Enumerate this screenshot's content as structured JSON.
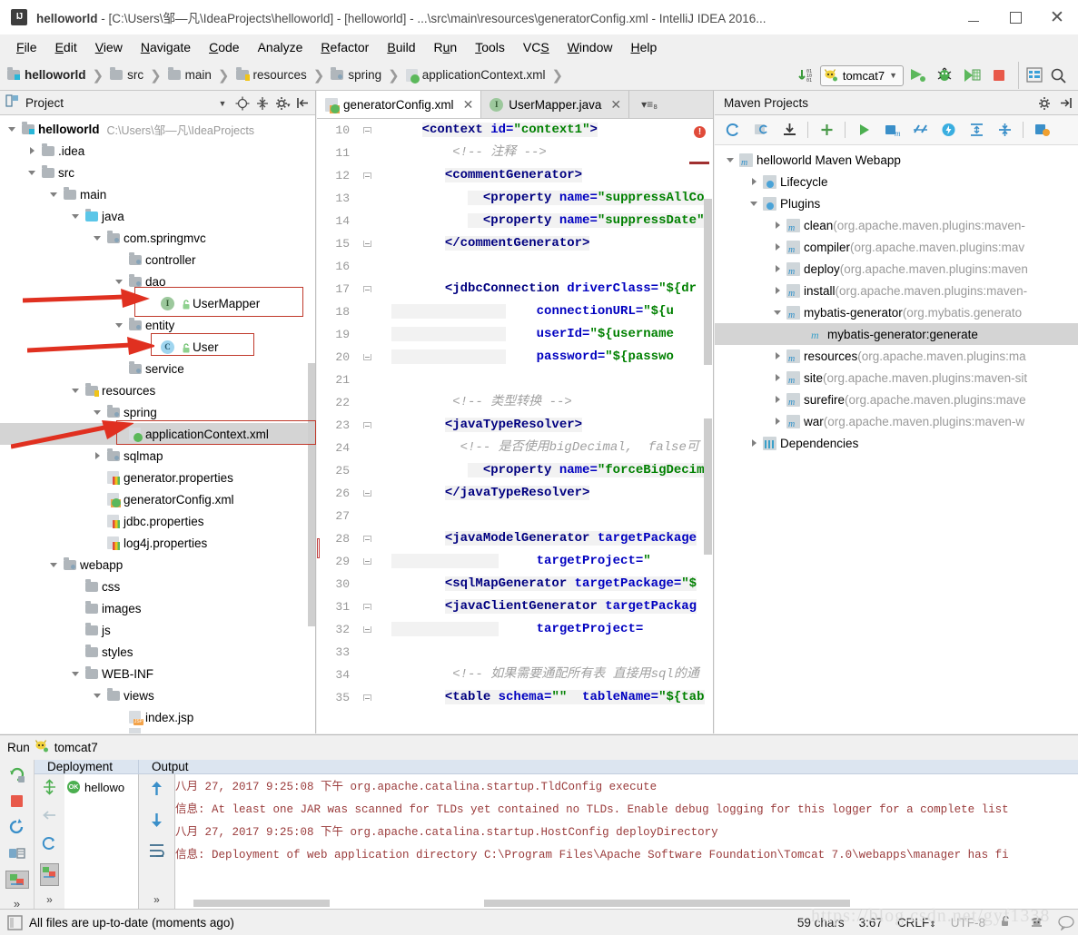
{
  "window": {
    "title_prefix": "helloworld",
    "title_rest": " - [C:\\Users\\邹—凡\\IdeaProjects\\helloworld] - [helloworld] - ...\\src\\main\\resources\\generatorConfig.xml - IntelliJ IDEA 2016...",
    "app_icon": "IJ",
    "minimize": "—",
    "maximize": "□",
    "close": "✕"
  },
  "menubar": {
    "items": [
      "File",
      "Edit",
      "View",
      "Navigate",
      "Code",
      "Analyze",
      "Refactor",
      "Build",
      "Run",
      "Tools",
      "VCS",
      "Window",
      "Help"
    ]
  },
  "navbar": {
    "breadcrumbs": [
      {
        "label": "helloworld",
        "icon": "module-folder-icon",
        "bold": true
      },
      {
        "label": "src",
        "icon": "folder-icon",
        "bold": false
      },
      {
        "label": "main",
        "icon": "folder-icon",
        "bold": false
      },
      {
        "label": "resources",
        "icon": "resources-folder-icon",
        "bold": false
      },
      {
        "label": "spring",
        "icon": "source-folder-icon",
        "bold": false
      },
      {
        "label": "applicationContext.xml",
        "icon": "xml-file-icon",
        "bold": false
      }
    ],
    "run_config": "tomcat7",
    "toolbar_icons": [
      "update-project-icon",
      "run-icon",
      "debug-icon",
      "run-coverage-icon",
      "stop-icon",
      "project-structure-icon",
      "search-everywhere-icon"
    ]
  },
  "project_panel": {
    "title": "Project",
    "tools": [
      "collapse-dropdown-icon",
      "locate-icon",
      "collapse-all-icon",
      "settings-gear-icon",
      "hide-icon"
    ],
    "tree": [
      {
        "depth": 0,
        "twisty": "down",
        "icon": "module-folder-icon",
        "label": "helloworld",
        "bold": true,
        "path": "C:\\Users\\邹—凡\\IdeaProjects"
      },
      {
        "depth": 1,
        "twisty": "right",
        "icon": "folder-icon",
        "label": ".idea"
      },
      {
        "depth": 1,
        "twisty": "down",
        "icon": "folder-icon",
        "label": "src"
      },
      {
        "depth": 2,
        "twisty": "down",
        "icon": "folder-icon",
        "label": "main"
      },
      {
        "depth": 3,
        "twisty": "down",
        "icon": "source-root-icon",
        "label": "java"
      },
      {
        "depth": 4,
        "twisty": "down",
        "icon": "package-icon",
        "label": "com.springmvc"
      },
      {
        "depth": 5,
        "twisty": "none",
        "icon": "package-icon",
        "label": "controller"
      },
      {
        "depth": 5,
        "twisty": "down",
        "icon": "package-icon",
        "label": "dao"
      },
      {
        "depth": 6,
        "twisty": "none",
        "icon": "interface-icon",
        "label": "UserMapper",
        "annotated": true
      },
      {
        "depth": 5,
        "twisty": "down",
        "icon": "package-icon",
        "label": "entity"
      },
      {
        "depth": 6,
        "twisty": "none",
        "icon": "class-icon",
        "label": "User",
        "annotated": true
      },
      {
        "depth": 5,
        "twisty": "none",
        "icon": "package-icon",
        "label": "service"
      },
      {
        "depth": 3,
        "twisty": "down",
        "icon": "resources-folder-icon",
        "label": "resources"
      },
      {
        "depth": 4,
        "twisty": "down",
        "icon": "package-icon",
        "label": "spring"
      },
      {
        "depth": 5,
        "twisty": "none",
        "icon": "xml-file-icon",
        "label": "applicationContext.xml",
        "selected": true,
        "annotated": true
      },
      {
        "depth": 4,
        "twisty": "right",
        "icon": "package-icon",
        "label": "sqlmap"
      },
      {
        "depth": 4,
        "twisty": "none",
        "icon": "properties-file-icon",
        "label": "generator.properties"
      },
      {
        "depth": 4,
        "twisty": "none",
        "icon": "xml-code-file-icon",
        "label": "generatorConfig.xml"
      },
      {
        "depth": 4,
        "twisty": "none",
        "icon": "properties-file-icon",
        "label": "jdbc.properties"
      },
      {
        "depth": 4,
        "twisty": "none",
        "icon": "properties-file-icon",
        "label": "log4j.properties"
      },
      {
        "depth": 2,
        "twisty": "down",
        "icon": "webapp-folder-icon",
        "label": "webapp"
      },
      {
        "depth": 3,
        "twisty": "none",
        "icon": "folder-icon",
        "label": "css"
      },
      {
        "depth": 3,
        "twisty": "none",
        "icon": "folder-icon",
        "label": "images"
      },
      {
        "depth": 3,
        "twisty": "none",
        "icon": "folder-icon",
        "label": "js"
      },
      {
        "depth": 3,
        "twisty": "none",
        "icon": "folder-icon",
        "label": "styles"
      },
      {
        "depth": 3,
        "twisty": "down",
        "icon": "folder-icon",
        "label": "WEB-INF"
      },
      {
        "depth": 4,
        "twisty": "down",
        "icon": "folder-icon",
        "label": "views"
      },
      {
        "depth": 5,
        "twisty": "none",
        "icon": "jsp-file-icon",
        "label": "index.jsp"
      }
    ]
  },
  "editor": {
    "tabs": [
      {
        "label": "generatorConfig.xml",
        "icon": "xml-code-file-icon",
        "active": true,
        "close": "✕"
      },
      {
        "label": "UserMapper.java",
        "icon": "interface-icon",
        "active": false,
        "close": "✕"
      }
    ],
    "tab_more": "▾≡₈",
    "error_badge": "!",
    "first_line": 10,
    "lines": [
      {
        "n": 10,
        "fold": "start",
        "html": "    <span class='hl'><span class='tag'>&lt;context </span><span class='attr'>id=</span><span class='str'>\"context1\"</span><span class='tag'>&gt;</span></span>"
      },
      {
        "n": 11,
        "fold": "",
        "html": "        <span class='cmt'>&lt;!-- 注释 --&gt;</span>"
      },
      {
        "n": 12,
        "fold": "start",
        "html": "       <span class='hl'><span class='tag'>&lt;commentGenerator&gt;</span></span>"
      },
      {
        "n": 13,
        "fold": "",
        "html": "          <span class='hl'>  <span class='tag'>&lt;property </span><span class='attr'>name=</span><span class='str'>\"suppressAllCo</span></span>"
      },
      {
        "n": 14,
        "fold": "",
        "html": "          <span class='hl'>  <span class='tag'>&lt;property </span><span class='attr'>name=</span><span class='str'>\"suppressDate\"</span></span>"
      },
      {
        "n": 15,
        "fold": "end",
        "html": "       <span class='hl'><span class='tag'>&lt;/commentGenerator&gt;</span></span>"
      },
      {
        "n": 16,
        "fold": "",
        "html": ""
      },
      {
        "n": 17,
        "fold": "start",
        "html": "       <span class='tag'>&lt;jdbcConnection </span><span class='attr'>driverClass=</span><span class='str'>\"$&#123;dr</span>"
      },
      {
        "n": 18,
        "fold": "",
        "html": "<span class='hl'>               </span>    <span class='attr'>connectionURL=</span><span class='str'>\"$&#123;u</span>"
      },
      {
        "n": 19,
        "fold": "",
        "html": "<span class='hl'>               </span>    <span class='attr'>userId=</span><span class='str'>\"$&#123;username</span>"
      },
      {
        "n": 20,
        "fold": "end",
        "html": "<span class='hl'>               </span>    <span class='attr'>password=</span><span class='str'>\"$&#123;passwo</span>"
      },
      {
        "n": 21,
        "fold": "",
        "html": ""
      },
      {
        "n": 22,
        "fold": "",
        "html": "        <span class='cmt'>&lt;!-- 类型转换 --&gt;</span>"
      },
      {
        "n": 23,
        "fold": "start",
        "html": "       <span class='hl'><span class='tag'>&lt;javaTypeResolver&gt;</span></span>"
      },
      {
        "n": 24,
        "fold": "",
        "html": "         <span class='cmt'>&lt;!-- 是否使用bigDecimal,  false可</span>"
      },
      {
        "n": 25,
        "fold": "",
        "html": "          <span class='hl'>  <span class='tag'>&lt;property </span><span class='attr'>name=</span><span class='str'>\"forceBigDecim</span></span>"
      },
      {
        "n": 26,
        "fold": "end",
        "html": "       <span class='hl'><span class='tag'>&lt;/javaTypeResolver&gt;</span></span>"
      },
      {
        "n": 27,
        "fold": "",
        "html": ""
      },
      {
        "n": 28,
        "fold": "start",
        "html": "       <span class='hl'><span class='tag'>&lt;javaModelGenerator </span><span class='attr'>targetPackage</span></span>"
      },
      {
        "n": 29,
        "fold": "end",
        "html": "<span class='hl'>              </span>     <span class='attr'>targetProject=</span><span class='str'>\"</span>"
      },
      {
        "n": 30,
        "fold": "",
        "html": "       <span class='hl'><span class='tag'>&lt;sqlMapGenerator </span><span class='attr'>targetPackage=</span><span class='str'>\"$</span></span>"
      },
      {
        "n": 31,
        "fold": "start",
        "html": "       <span class='hl'><span class='tag'>&lt;javaClientGenerator </span><span class='attr'>targetPackag</span></span>"
      },
      {
        "n": 32,
        "fold": "end",
        "html": "<span class='hl'>              </span>     <span class='attr'>targetProject=</span>"
      },
      {
        "n": 33,
        "fold": "",
        "html": ""
      },
      {
        "n": 34,
        "fold": "",
        "html": "        <span class='cmt'>&lt;!-- 如果需要通配所有表 直接用sql的通</span>"
      },
      {
        "n": 35,
        "fold": "start",
        "html": "       <span class='hl'><span class='tag'>&lt;table </span><span class='attr'>schema=</span><span class='str'>\"\"</span><span class='attr'>  tableName=</span><span class='str'>\"$&#123;tab</span></span>"
      }
    ]
  },
  "maven_panel": {
    "title": "Maven Projects",
    "head_tools": [
      "settings-gear-icon",
      "hide-icon"
    ],
    "toolbar_icons": [
      "reimport-icon",
      "generate-sources-icon",
      "download-sources-icon",
      "add-icon",
      "run-icon",
      "run-maven-goal-icon",
      "toggle-skip-tests-icon",
      "execute-icon",
      "expand-icon",
      "collapse-icon",
      "maven-settings-icon"
    ],
    "tree": [
      {
        "depth": 0,
        "twisty": "down",
        "icon": "maven-project-icon",
        "label": "helloworld Maven Webapp",
        "gray": ""
      },
      {
        "depth": 1,
        "twisty": "right",
        "icon": "lifecycle-icon",
        "label": "Lifecycle",
        "gray": ""
      },
      {
        "depth": 1,
        "twisty": "down",
        "icon": "plugins-icon",
        "label": "Plugins",
        "gray": ""
      },
      {
        "depth": 2,
        "twisty": "right",
        "icon": "maven-plugin-icon",
        "label": "clean",
        "gray": " (org.apache.maven.plugins:maven-"
      },
      {
        "depth": 2,
        "twisty": "right",
        "icon": "maven-plugin-icon",
        "label": "compiler",
        "gray": " (org.apache.maven.plugins:mav"
      },
      {
        "depth": 2,
        "twisty": "right",
        "icon": "maven-plugin-icon",
        "label": "deploy",
        "gray": " (org.apache.maven.plugins:maven"
      },
      {
        "depth": 2,
        "twisty": "right",
        "icon": "maven-plugin-icon",
        "label": "install",
        "gray": " (org.apache.maven.plugins:maven-"
      },
      {
        "depth": 2,
        "twisty": "down",
        "icon": "maven-plugin-icon",
        "label": "mybatis-generator",
        "gray": " (org.mybatis.generato"
      },
      {
        "depth": 3,
        "twisty": "none",
        "icon": "maven-goal-icon",
        "label": "mybatis-generator:generate",
        "gray": "",
        "selected": true
      },
      {
        "depth": 2,
        "twisty": "right",
        "icon": "maven-plugin-icon",
        "label": "resources",
        "gray": " (org.apache.maven.plugins:ma"
      },
      {
        "depth": 2,
        "twisty": "right",
        "icon": "maven-plugin-icon",
        "label": "site",
        "gray": " (org.apache.maven.plugins:maven-sit"
      },
      {
        "depth": 2,
        "twisty": "right",
        "icon": "maven-plugin-icon",
        "label": "surefire",
        "gray": " (org.apache.maven.plugins:mave"
      },
      {
        "depth": 2,
        "twisty": "right",
        "icon": "maven-plugin-icon",
        "label": "war",
        "gray": " (org.apache.maven.plugins:maven-w"
      },
      {
        "depth": 1,
        "twisty": "right",
        "icon": "dependencies-icon",
        "label": "Dependencies",
        "gray": ""
      }
    ]
  },
  "run_panel": {
    "title": "Run",
    "config_name": "tomcat7",
    "side_icons": [
      "rerun-icon",
      "stop-icon",
      "restart-icon",
      "show-console-icon",
      "deploy-icon"
    ],
    "tabs": [
      {
        "label": "Deployment",
        "active": false
      },
      {
        "label": "Output",
        "active": true
      }
    ],
    "deployment_icons": [
      "sort-icon",
      "back-icon",
      "refresh-icon",
      "deploy-artifact-icon"
    ],
    "deployment_items": [
      {
        "label": "hellowo",
        "status": "ok"
      }
    ],
    "output_icons": [
      "up-arrow-icon",
      "down-arrow-icon",
      "soft-wrap-icon"
    ],
    "output_lines": [
      "八月 27, 2017 9:25:08 下午 org.apache.catalina.startup.TldConfig execute",
      "信息: At least one JAR was scanned for TLDs yet contained no TLDs. Enable debug logging for this logger for a complete list",
      "八月 27, 2017 9:25:08 下午 org.apache.catalina.startup.HostConfig deployDirectory",
      "信息: Deployment of web application directory C:\\Program Files\\Apache Software Foundation\\Tomcat 7.0\\webapps\\manager has fi"
    ]
  },
  "statusbar": {
    "message": "All files are up-to-date (moments ago)",
    "chars": "59 chars",
    "caret": "3:67",
    "line_separator": "CRLF",
    "encoding": "UTF-8",
    "lock_icon": "unlocked-icon",
    "hector_icon": "hector-icon",
    "event_icon": "event-log-icon"
  },
  "watermark": "https://blog.csdn.net/gyf1338",
  "colors": {
    "annotation_red": "#c0392b",
    "selection_gray": "#d4d4d4",
    "tab_active": "#ffffff",
    "accent_green": "#4caf50",
    "output_text": "#9a3b3b"
  }
}
